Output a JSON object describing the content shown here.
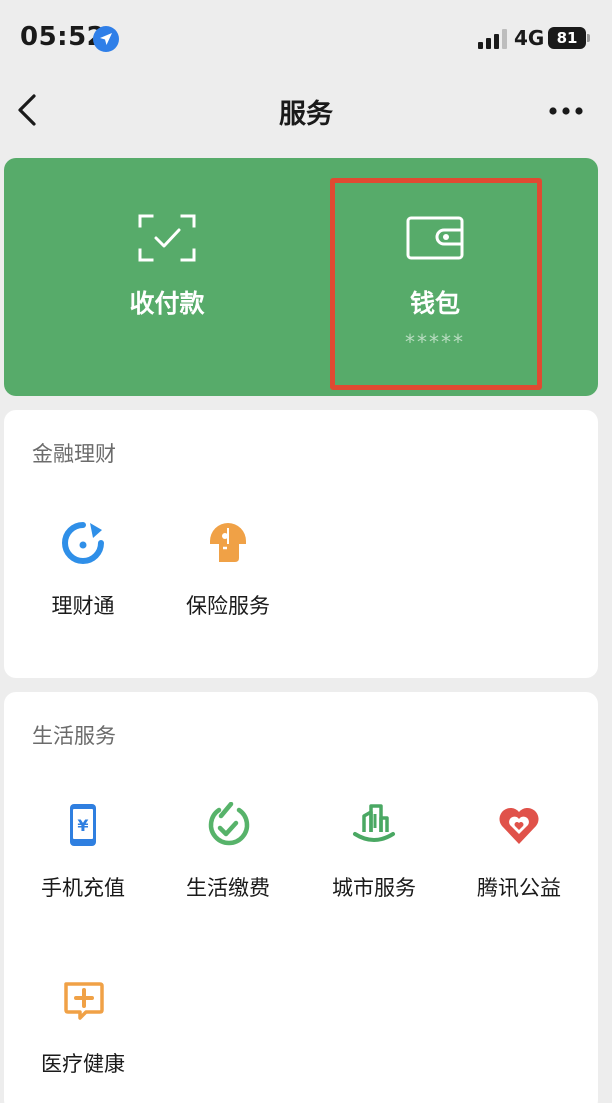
{
  "status_bar": {
    "time": "05:52",
    "network": "4G",
    "battery": "81",
    "icons": [
      "location-arrow-icon",
      "signal-bars-icon",
      "battery-icon"
    ]
  },
  "nav": {
    "title": "服务",
    "icons": [
      "back-chevron-icon",
      "more-dots-icon"
    ]
  },
  "top_card": {
    "background": "#57ab6a",
    "pay": {
      "label": "收付款",
      "icon": "scan-check-icon"
    },
    "wallet": {
      "label": "钱包",
      "sub": "*****",
      "icon": "wallet-icon"
    },
    "highlight_color": "#e04a32"
  },
  "finance": {
    "title": "金融理财",
    "items": [
      {
        "label": "理财通",
        "icon": "licaitong-icon",
        "color": "#2f8fe8"
      },
      {
        "label": "保险服务",
        "icon": "insurance-icon",
        "color": "#f0a146"
      }
    ]
  },
  "life": {
    "title": "生活服务",
    "items": [
      {
        "label": "手机充值",
        "icon": "phone-recharge-icon",
        "color": "#2f7fe0"
      },
      {
        "label": "生活缴费",
        "icon": "utility-payment-icon",
        "color": "#57b36a"
      },
      {
        "label": "城市服务",
        "icon": "city-service-icon",
        "color": "#4aa863"
      },
      {
        "label": "腾讯公益",
        "icon": "charity-heart-icon",
        "color": "#e0524a"
      },
      {
        "label": "医疗健康",
        "icon": "medical-health-icon",
        "color": "#f0a146"
      }
    ]
  }
}
